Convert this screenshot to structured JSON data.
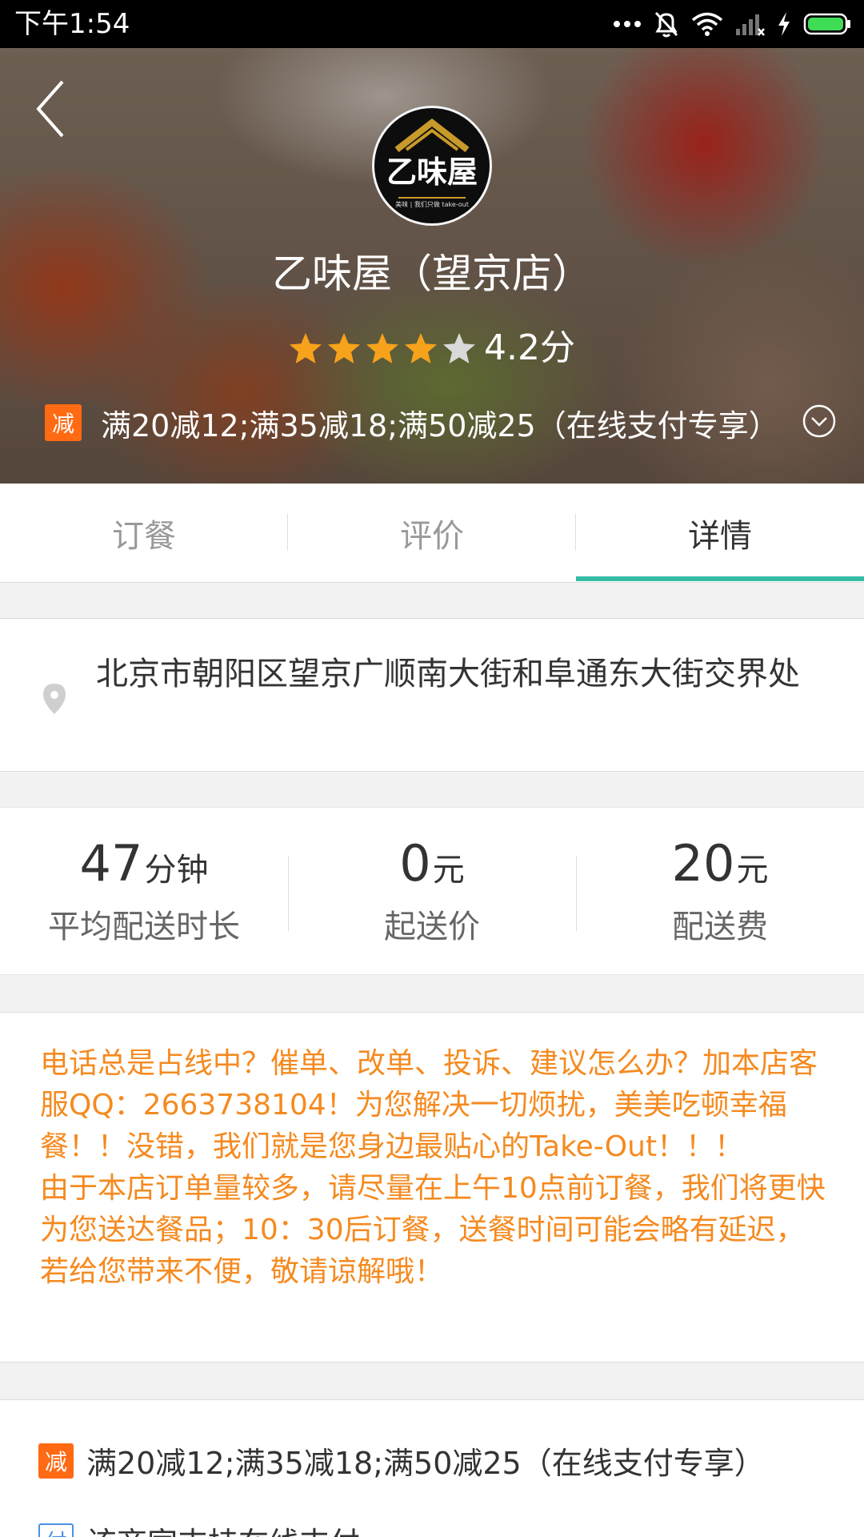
{
  "status_bar": {
    "time": "下午1:54"
  },
  "store": {
    "name": "乙味屋（望京店）",
    "rating_text": "4.2分",
    "rating_value": 4.2,
    "rating_max": 5,
    "logo": {
      "main": "乙味屋",
      "tagline": "美味 | 我们只做 take-out"
    },
    "promo_badge": "减",
    "promo_text": "满20减12;满35减18;满50减25（在线支付专享）"
  },
  "tabs": [
    {
      "label": "订餐",
      "active": false
    },
    {
      "label": "评价",
      "active": false
    },
    {
      "label": "详情",
      "active": true
    }
  ],
  "details": {
    "address": "北京市朝阳区望京广顺南大街和阜通东大街交界处",
    "stats": [
      {
        "value": "47",
        "unit": "分钟",
        "label": "平均配送时长"
      },
      {
        "value": "0",
        "unit": "元",
        "label": "起送价"
      },
      {
        "value": "20",
        "unit": "元",
        "label": "配送费"
      }
    ],
    "notice": "电话总是占线中？催单、改单、投诉、建议怎么办？加本店客服QQ：2663738104！为您解决一切烦扰，美美吃顿幸福餐！！没错，我们就是您身边最贴心的Take-Out！！！\n由于本店订单量较多，请尽量在上午10点前订餐，我们将更快为您送达餐品；10：30后订餐，送餐时间可能会略有延迟，若给您带来不便，敬请谅解哦！",
    "activities": [
      {
        "badge": "减",
        "text": "满20减12;满35减18;满50减25（在线支付专享）"
      },
      {
        "badge": "付",
        "text": "该商家支持在线支付"
      }
    ]
  },
  "colors": {
    "accent": "#35bca4",
    "promo_badge": "#ff6a13",
    "notice_text": "#f58a1f",
    "star": "#f7a21b",
    "pay_badge": "#4a90e2"
  }
}
